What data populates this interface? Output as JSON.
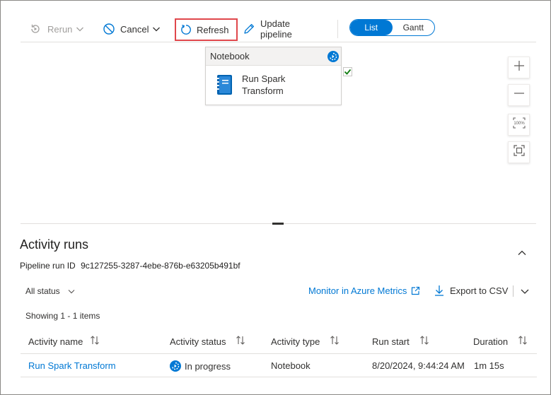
{
  "toolbar": {
    "rerun_label": "Rerun",
    "cancel_label": "Cancel",
    "refresh_label": "Refresh",
    "update_label": "Update pipeline",
    "view_toggle": {
      "options": [
        "List",
        "Gantt"
      ],
      "selected": "List"
    }
  },
  "canvas": {
    "activity_card": {
      "type_label": "Notebook",
      "name_line1": "Run Spark",
      "name_line2": "Transform",
      "status_icon": "in-progress-icon",
      "icon": "notebook-icon"
    },
    "zoom_controls": [
      "zoom-in-icon",
      "zoom-out-icon",
      "zoom-100-icon",
      "fit-to-screen-icon"
    ],
    "zoom_100_label": "100%"
  },
  "activity_runs": {
    "title": "Activity runs",
    "pipeline_run_id_label": "Pipeline run ID",
    "pipeline_run_id": "9c127255-3287-4ebe-876b-e63205b491bf",
    "status_filter": "All status",
    "monitor_link": "Monitor in Azure Metrics",
    "export_label": "Export to CSV",
    "showing_text": "Showing 1 - 1 items",
    "columns": [
      "Activity name",
      "Activity status",
      "Activity type",
      "Run start",
      "Duration"
    ],
    "rows": [
      {
        "activity_name": "Run Spark Transform",
        "activity_status": "In progress",
        "activity_type": "Notebook",
        "run_start": "8/20/2024, 9:44:24 AM",
        "duration": "1m 15s"
      }
    ]
  },
  "colors": {
    "accent": "#0078d4",
    "highlight_border": "#e0474c",
    "success": "#107c10"
  }
}
